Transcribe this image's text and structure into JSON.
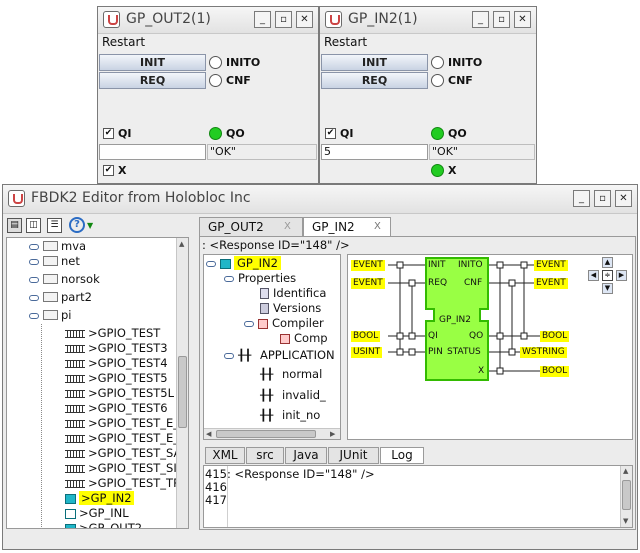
{
  "win_out": {
    "title": "GP_OUT2(1)",
    "menu": "Restart",
    "init_button": "INIT",
    "req_button": "REQ",
    "inito": "INITO",
    "cnf": "CNF",
    "qi": "QI",
    "qo": "QO",
    "pin_value": "",
    "status_value": "\"OK\"",
    "x": "X"
  },
  "win_in": {
    "title": "GP_IN2(1)",
    "menu": "Restart",
    "init_button": "INIT",
    "req_button": "REQ",
    "inito": "INITO",
    "cnf": "CNF",
    "qi": "QI",
    "qo": "QO",
    "pin_value": "5",
    "status_value": "\"OK\"",
    "x": "X"
  },
  "editor": {
    "title": "FBDK2 Editor from Holobloc Inc",
    "tabs": [
      {
        "label": "GP_OUT2",
        "close": "X"
      },
      {
        "label": "GP_IN2",
        "close": "X"
      }
    ],
    "response_header": ": <Response ID=\"148\" />",
    "tree_left": [
      "mva",
      "net",
      "norsok",
      "part2",
      "pi",
      ">GPIO_TEST",
      ">GPIO_TEST3",
      ">GPIO_TEST4",
      ">GPIO_TEST5",
      ">GPIO_TEST5L",
      ">GPIO_TEST6",
      ">GPIO_TEST_E_",
      ">GPIO_TEST_E_I",
      ">GPIO_TEST_SA",
      ">GPIO_TEST_SIN",
      ">GPIO_TEST_TR",
      ">GP_IN2",
      ">GP_INL",
      ">GP_OUT2"
    ],
    "tree_mid": [
      "GP_IN2",
      "Properties",
      "Identifica",
      "Versions",
      "Compiler",
      "Comp",
      "APPLICATION",
      "normal",
      "invalid_",
      "init_no"
    ],
    "fb": {
      "name": "GP_IN2",
      "event_inputs": [
        "INIT",
        "REQ"
      ],
      "event_outputs": [
        "INITO",
        "CNF"
      ],
      "data_inputs": [
        "QI",
        "PIN"
      ],
      "data_outputs": [
        "QO",
        "STATUS",
        "X"
      ],
      "left_types": [
        "EVENT",
        "EVENT",
        "BOOL",
        "USINT"
      ],
      "right_types": [
        "EVENT",
        "EVENT",
        "BOOL",
        "WSTRING",
        "BOOL"
      ]
    },
    "bottom_tabs": [
      "XML",
      "src",
      "Java",
      "JUnit",
      "Log"
    ],
    "log_lines": [
      "415: <Response ID=\"148\" />",
      "416",
      "417"
    ]
  }
}
